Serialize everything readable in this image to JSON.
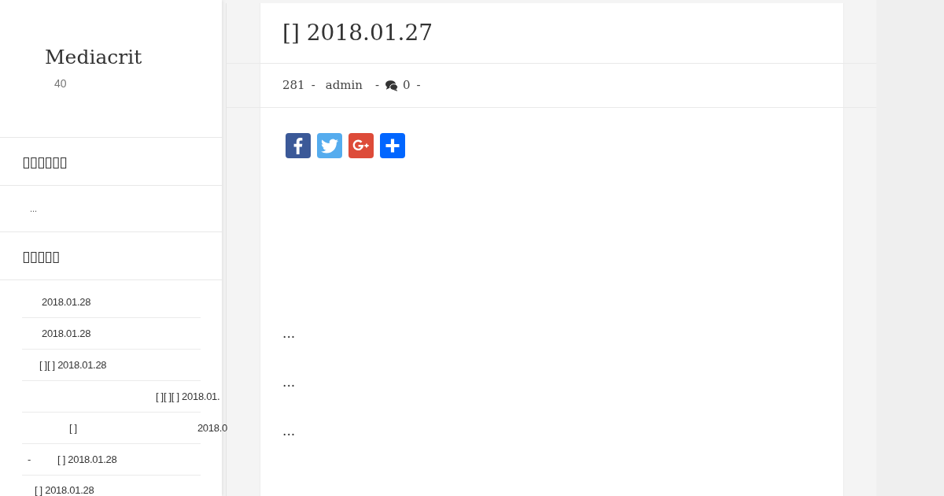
{
  "sidebar": {
    "site_title": "Mediacrit",
    "tagline": "40",
    "widgets": [
      {
        "kind": "text",
        "title": "▯▯▯▯▯▯",
        "text": "..."
      },
      {
        "kind": "list",
        "title": "▯▯▯▯▯",
        "items": [
          {
            "parts": [
              "2018.01.28"
            ]
          },
          {
            "parts": [
              "2018.01.28"
            ]
          },
          {
            "parts": [
              "[ ][ ] 2018.01.28"
            ]
          },
          {
            "parts": [
              "[ ][ ][ ] 2018.01."
            ]
          },
          {
            "parts": [
              "[ ]",
              "2018.0"
            ]
          },
          {
            "parts": [
              "-",
              "[ ] 2018.01.28"
            ]
          },
          {
            "parts": [
              "[ ] 2018.01.28"
            ]
          }
        ]
      }
    ]
  },
  "post": {
    "title": "[] 2018.01.27",
    "meta": [
      {
        "kind": "views",
        "text": "281"
      },
      {
        "kind": "separator",
        "text": "-"
      },
      {
        "kind": "author",
        "text": "admin"
      },
      {
        "kind": "separator",
        "text": "-"
      },
      {
        "kind": "comments",
        "text": "0"
      },
      {
        "kind": "separator",
        "text": "-"
      }
    ],
    "share_buttons": [
      {
        "kind": "facebook"
      },
      {
        "kind": "twitter"
      },
      {
        "kind": "google_plus"
      },
      {
        "kind": "share"
      }
    ],
    "paragraphs": [
      "...",
      "...",
      "..."
    ]
  }
}
